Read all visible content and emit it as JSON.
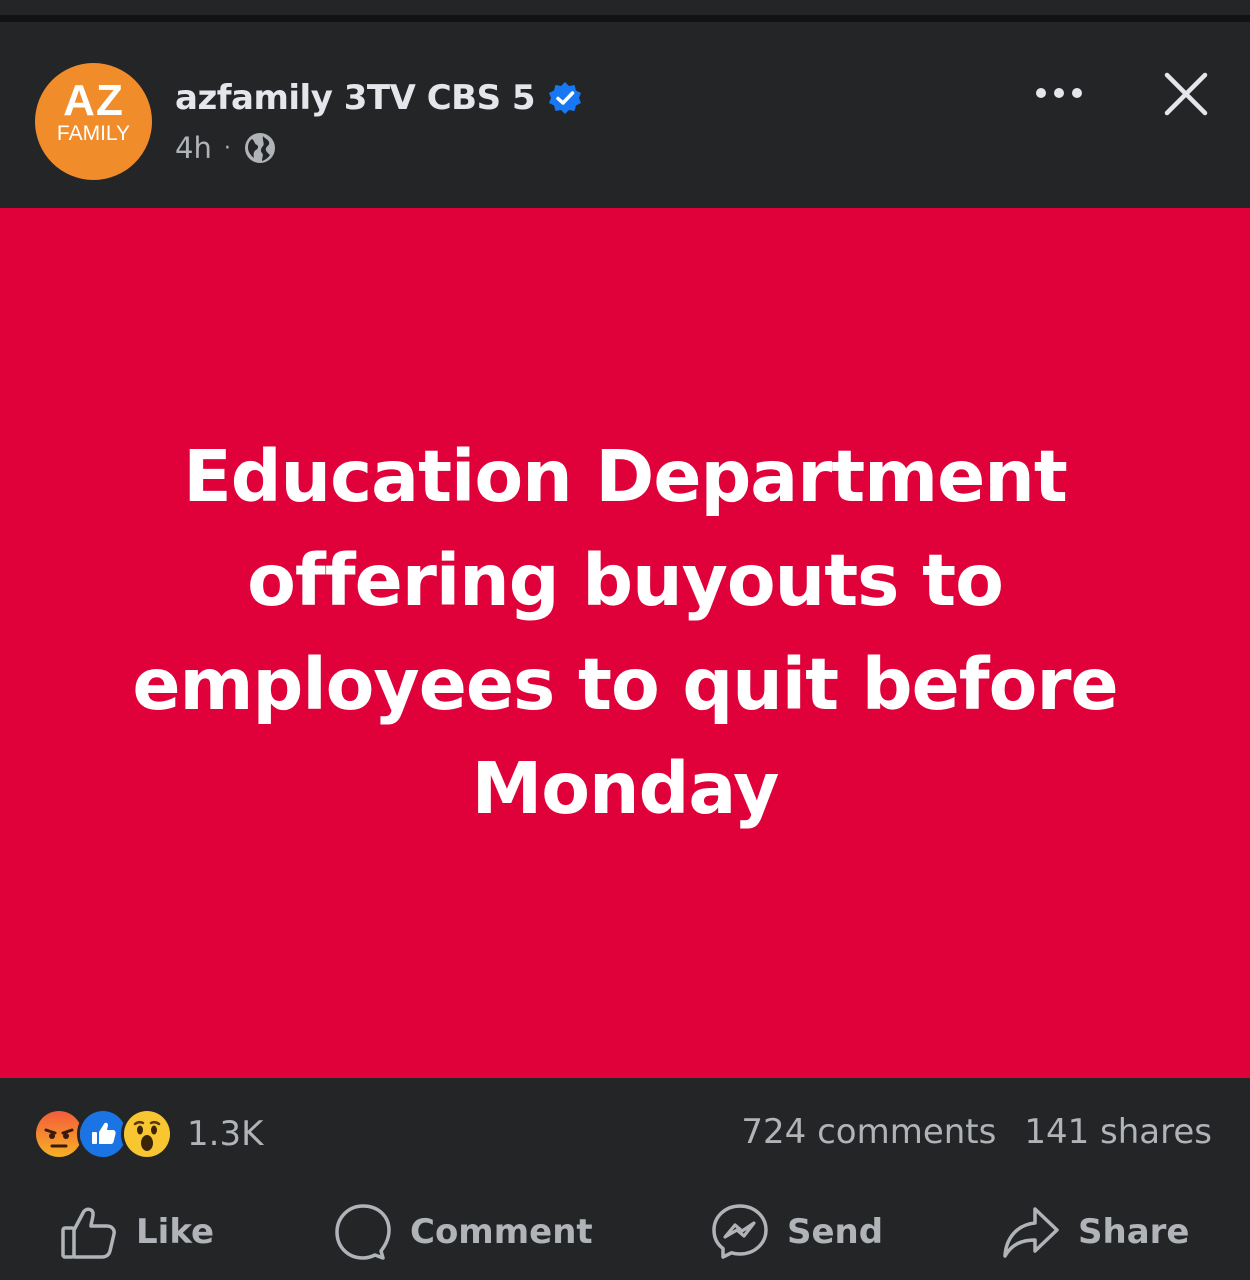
{
  "header": {
    "page_name": "azfamily 3TV CBS 5",
    "time": "4h",
    "separator": "·",
    "avatar": {
      "line1": "AZ",
      "line2": "FAMILY"
    },
    "verified_icon": "verified-badge-icon",
    "audience_icon": "globe-icon",
    "more_icon": "more-options-icon",
    "close_icon": "close-icon"
  },
  "post": {
    "text": "Education Department offering buyouts to employees to quit before Monday",
    "background_color": "#e0003a"
  },
  "stats": {
    "reactions": [
      "angry",
      "like",
      "wow"
    ],
    "reaction_count": "1.3K",
    "comments": "724 comments",
    "shares": "141 shares"
  },
  "actions": [
    {
      "label": "Like",
      "icon": "thumbs-up-icon"
    },
    {
      "label": "Comment",
      "icon": "comment-bubble-icon"
    },
    {
      "label": "Send",
      "icon": "messenger-icon"
    },
    {
      "label": "Share",
      "icon": "share-arrow-icon"
    }
  ],
  "colors": {
    "background": "#242526",
    "text_primary": "#e4e6eb",
    "text_secondary": "#b0b3b8",
    "verified_blue": "#1877f2",
    "avatar_orange": "#f08c2a"
  }
}
